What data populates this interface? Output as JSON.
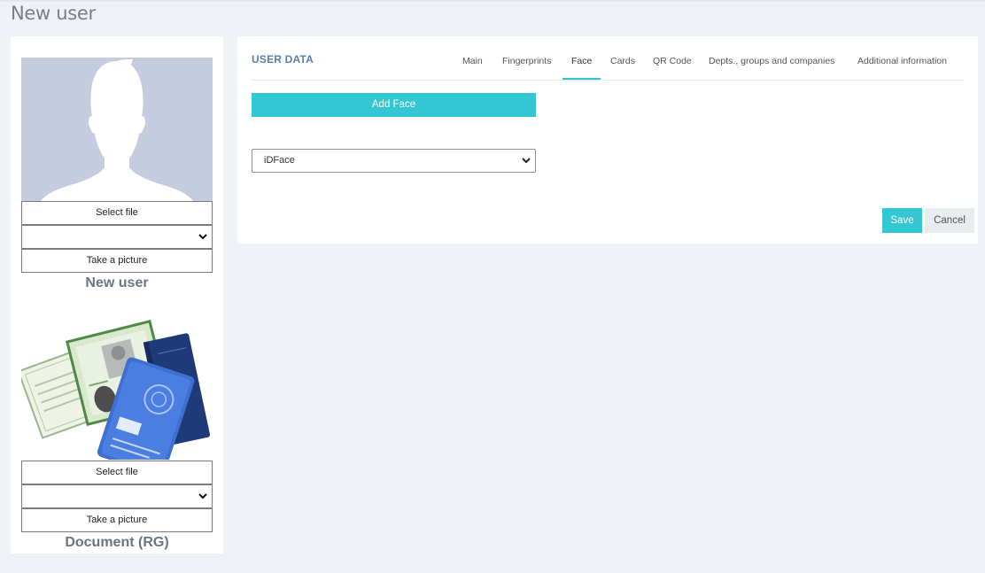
{
  "page": {
    "title": "New user"
  },
  "user_photo": {
    "select_file_label": "Select file",
    "select_value": "",
    "take_picture_label": "Take a picture",
    "caption": "New user"
  },
  "document_photo": {
    "select_file_label": "Select file",
    "select_value": "",
    "take_picture_label": "Take a picture",
    "caption": "Document (RG)"
  },
  "user_data": {
    "section_title": "USER DATA",
    "tabs": [
      {
        "label": "Main",
        "active": false
      },
      {
        "label": "Fingerprints",
        "active": false
      },
      {
        "label": "Face",
        "active": true
      },
      {
        "label": "Cards",
        "active": false
      },
      {
        "label": "QR Code",
        "active": false
      },
      {
        "label": "Depts., groups and companies",
        "active": false
      },
      {
        "label": "Additional information",
        "active": false
      }
    ],
    "add_face_label": "Add Face",
    "device_select_value": "iDFace",
    "save_label": "Save",
    "cancel_label": "Cancel"
  },
  "colors": {
    "accent": "#33c6d3",
    "section_title": "#5a7fa8",
    "avatar_bg": "#c6cce0",
    "page_bg": "#eef1f6"
  }
}
